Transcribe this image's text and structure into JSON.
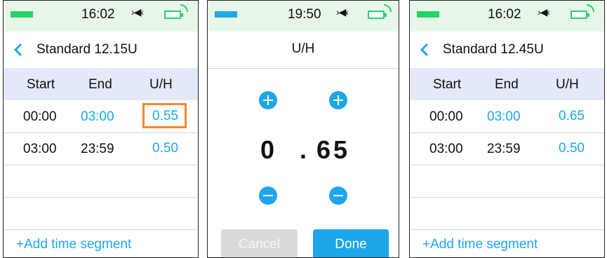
{
  "screen1": {
    "time": "16:02",
    "sound_glyph": "›◀‹",
    "title": "Standard 12.15U",
    "columns": [
      "Start",
      "End",
      "U/H"
    ],
    "rows": [
      {
        "start": "00:00",
        "end": "03:00",
        "rate": "0.55"
      },
      {
        "start": "03:00",
        "end": "23:59",
        "rate": "0.50"
      }
    ],
    "add_label": "+Add time segment"
  },
  "screen2": {
    "time": "19:50",
    "sound_glyph": "›◀‹",
    "title": "U/H",
    "integer_digit": "0",
    "decimal_point": ".",
    "decimal_digits": "65",
    "cancel_label": "Cancel",
    "done_label": "Done"
  },
  "screen3": {
    "time": "16:02",
    "sound_glyph": "›◀‹",
    "title": "Standard 12.45U",
    "columns": [
      "Start",
      "End",
      "U/H"
    ],
    "rows": [
      {
        "start": "00:00",
        "end": "03:00",
        "rate": "0.65"
      },
      {
        "start": "03:00",
        "end": "23:59",
        "rate": "0.50"
      }
    ],
    "add_label": "+Add time segment"
  },
  "colors": {
    "accent": "#1da6ea",
    "battery_green": "#25d366",
    "highlight": "#f28a2f",
    "status_bg": "#e8f6ea",
    "header_row_bg": "#e4e9f8"
  },
  "icons": [
    "battery-icon",
    "sound-icon",
    "battery-full-icon",
    "signal-icon",
    "back-chevron-icon",
    "plus-icon",
    "minus-icon"
  ]
}
